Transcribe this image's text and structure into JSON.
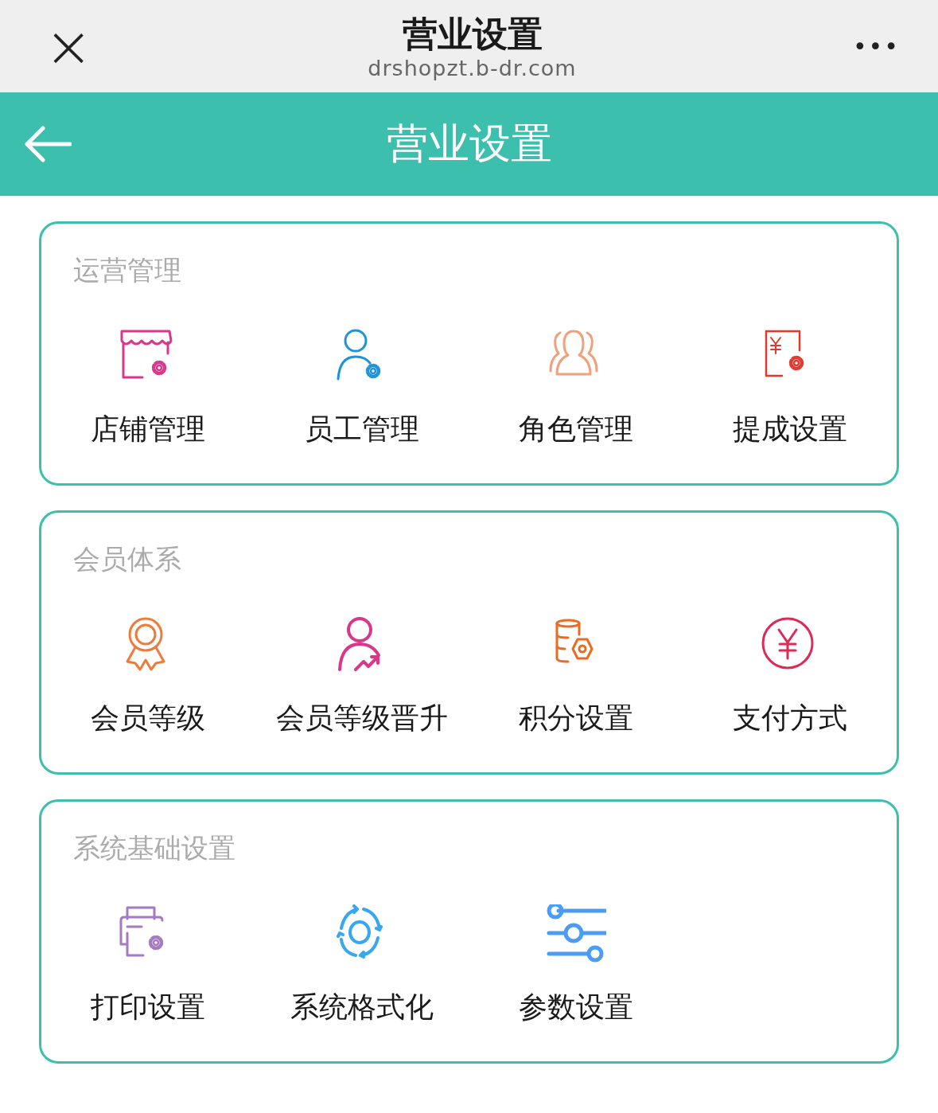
{
  "browser_bar": {
    "close": "×",
    "title": "营业设置",
    "url": "drshopzt.b-dr.com",
    "more": "•••"
  },
  "header": {
    "title": "营业设置"
  },
  "sections": [
    {
      "title": "运营管理",
      "items": [
        {
          "label": "店铺管理"
        },
        {
          "label": "员工管理"
        },
        {
          "label": "角色管理"
        },
        {
          "label": "提成设置"
        }
      ]
    },
    {
      "title": "会员体系",
      "items": [
        {
          "label": "会员等级"
        },
        {
          "label": "会员等级晋升"
        },
        {
          "label": "积分设置"
        },
        {
          "label": "支付方式"
        }
      ]
    },
    {
      "title": "系统基础设置",
      "items": [
        {
          "label": "打印设置"
        },
        {
          "label": "系统格式化"
        },
        {
          "label": "参数设置"
        }
      ]
    }
  ]
}
